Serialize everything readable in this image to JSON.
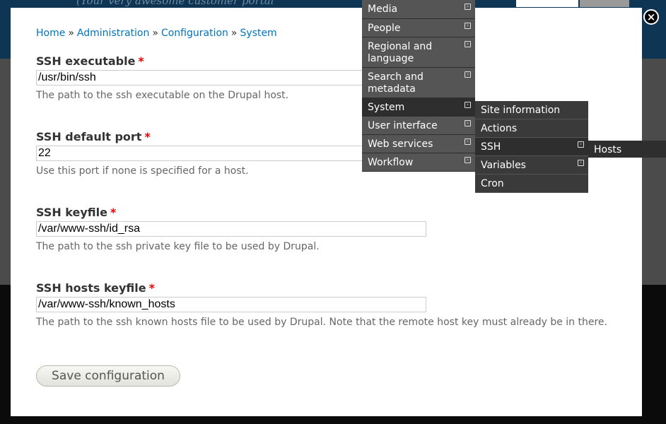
{
  "background": {
    "tagline": "(Your very awesome customer portal"
  },
  "breadcrumb": {
    "home": "Home",
    "administration": "Administration",
    "configuration": "Configuration",
    "system": "System",
    "separator": "»"
  },
  "fields": {
    "ssh_executable": {
      "label": "SSH executable",
      "required": "*",
      "value": "/usr/bin/ssh",
      "description": "The path to the ssh executable on the Drupal host."
    },
    "ssh_port": {
      "label": "SSH default port",
      "required": "*",
      "value": "22",
      "description": "Use this port if none is specified for a host."
    },
    "ssh_keyfile": {
      "label": "SSH keyfile",
      "required": "*",
      "value": "/var/www-ssh/id_rsa",
      "description": "The path to the ssh private key file to be used by Drupal."
    },
    "ssh_hosts_keyfile": {
      "label": "SSH hosts keyfile",
      "required": "*",
      "value": "/var/www-ssh/known_hosts",
      "description": "The path to the ssh known hosts file to be used by Drupal. Note that the remote host key must already be in there."
    }
  },
  "save_button": "Save configuration",
  "close_icon": "×",
  "menu": {
    "level1": [
      "Media",
      "People",
      "Regional and language",
      "Search and metadata",
      "System",
      "User interface",
      "Web services",
      "Workflow"
    ],
    "level2": [
      "Site information",
      "Actions",
      "SSH",
      "Variables",
      "Cron"
    ],
    "level3": [
      "Hosts"
    ]
  },
  "colors": {
    "link": "#0074bd",
    "required": "#e00000",
    "menu_bg": "#555555",
    "menu_active": "#2e2e2e"
  }
}
